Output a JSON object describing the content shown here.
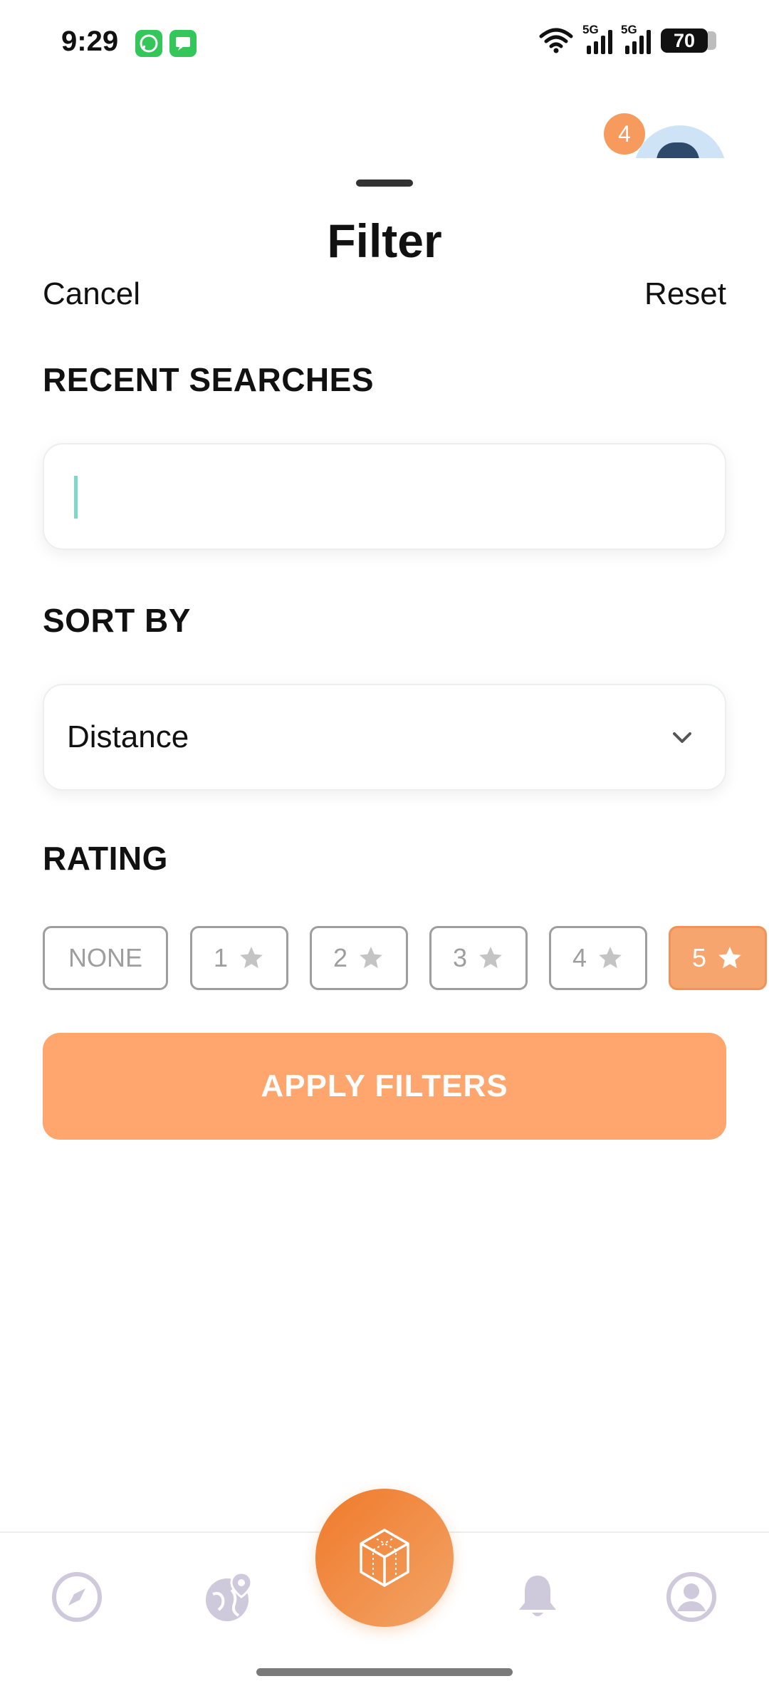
{
  "status_bar": {
    "time": "9:29",
    "network_1": "5G",
    "network_2": "5G",
    "battery": "70",
    "apps": [
      "whatsapp-icon",
      "messages-icon"
    ]
  },
  "header": {
    "notification_count": "4"
  },
  "sheet": {
    "title": "Filter",
    "cancel_label": "Cancel",
    "reset_label": "Reset"
  },
  "recent_searches": {
    "label": "RECENT SEARCHES",
    "value": ""
  },
  "sort_by": {
    "label": "SORT BY",
    "selected": "Distance"
  },
  "rating": {
    "label": "RATING",
    "options": [
      "NONE",
      "1",
      "2",
      "3",
      "4",
      "5"
    ],
    "selected": "5"
  },
  "apply_label": "APPLY FILTERS",
  "bottom_nav": {
    "items": [
      "compass-icon",
      "globe-pin-icon",
      "cube-icon",
      "bell-icon",
      "profile-icon"
    ]
  },
  "colors": {
    "accent": "#ffa56e",
    "fab_start": "#f07a2a",
    "fab_end": "#f2a468",
    "chip_border": "#9e9e9e",
    "nav_icon": "#cfc9dc"
  }
}
